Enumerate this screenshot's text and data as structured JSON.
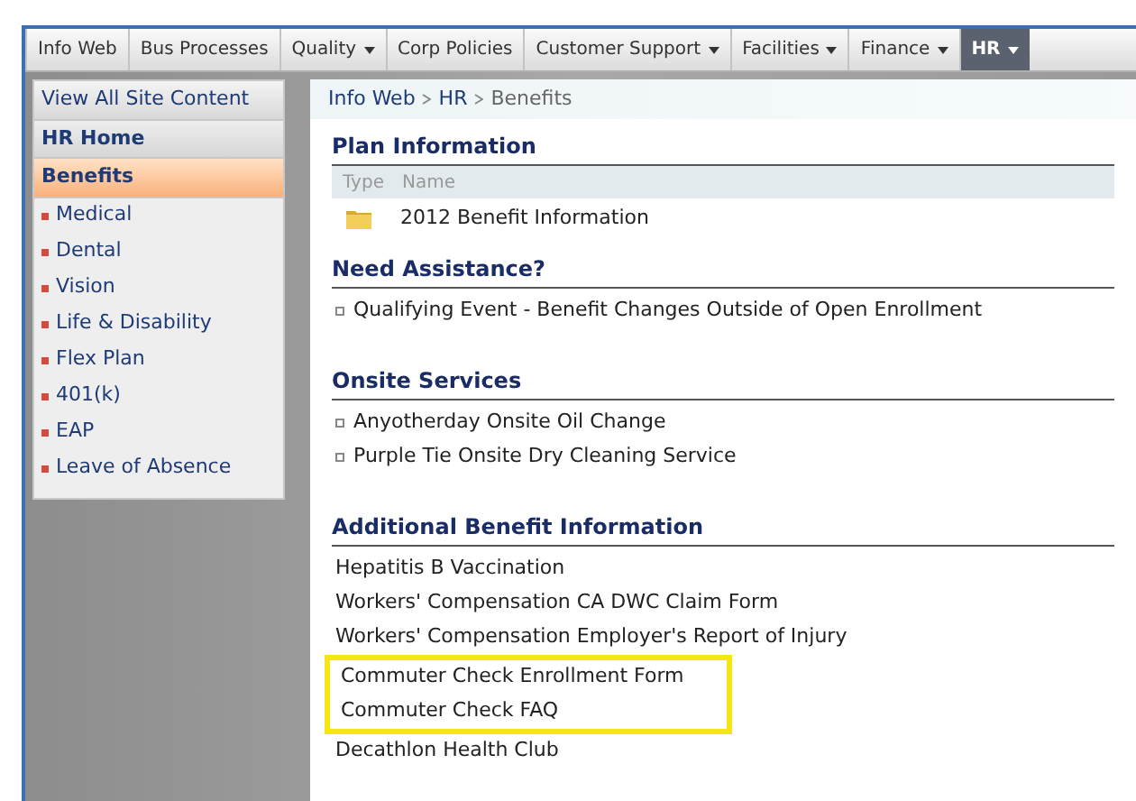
{
  "top_nav": [
    {
      "label": "Info Web",
      "dropdown": false,
      "selected": false
    },
    {
      "label": "Bus Processes",
      "dropdown": false,
      "selected": false
    },
    {
      "label": "Quality",
      "dropdown": true,
      "selected": false
    },
    {
      "label": "Corp Policies",
      "dropdown": false,
      "selected": false
    },
    {
      "label": "Customer Support",
      "dropdown": true,
      "selected": false
    },
    {
      "label": "Facilities",
      "dropdown": true,
      "selected": false
    },
    {
      "label": "Finance",
      "dropdown": true,
      "selected": false
    },
    {
      "label": "HR",
      "dropdown": true,
      "selected": true
    }
  ],
  "sidebar": {
    "view_all": "View All Site Content",
    "items": [
      {
        "label": "HR Home",
        "selected": false
      },
      {
        "label": "Benefits",
        "selected": true,
        "children": [
          "Medical",
          "Dental",
          "Vision",
          "Life & Disability",
          "Flex Plan",
          "401(k)",
          "EAP",
          "Leave of Absence"
        ]
      }
    ]
  },
  "breadcrumb": [
    "Info Web",
    "HR",
    "Benefits"
  ],
  "sections": [
    {
      "title": "Plan Information",
      "kind": "library",
      "columns": [
        "Type",
        "Name"
      ],
      "rows": [
        {
          "name": "2012 Benefit Information"
        }
      ]
    },
    {
      "title": "Need Assistance?",
      "kind": "bullets",
      "items": [
        {
          "text": "Qualifying Event - Benefit Changes Outside of Open Enrollment",
          "highlighted": false
        }
      ]
    },
    {
      "title": "Onsite Services",
      "kind": "bullets",
      "items": [
        {
          "text": "Anyotherday Onsite Oil Change",
          "highlighted": false
        },
        {
          "text": "Purple Tie Onsite Dry Cleaning Service",
          "highlighted": false
        }
      ]
    },
    {
      "title": "Additional Benefit Information",
      "kind": "links",
      "items": [
        {
          "text": "Hepatitis B Vaccination",
          "highlighted": false
        },
        {
          "text": "Workers' Compensation CA DWC Claim Form",
          "highlighted": false
        },
        {
          "text": "Workers' Compensation Employer's Report of Injury",
          "highlighted": false
        },
        {
          "text": "Commuter Check Enrollment Form",
          "highlighted": true
        },
        {
          "text": "Commuter Check FAQ",
          "highlighted": true
        },
        {
          "text": "Decathlon Health Club",
          "highlighted": false
        }
      ]
    }
  ]
}
